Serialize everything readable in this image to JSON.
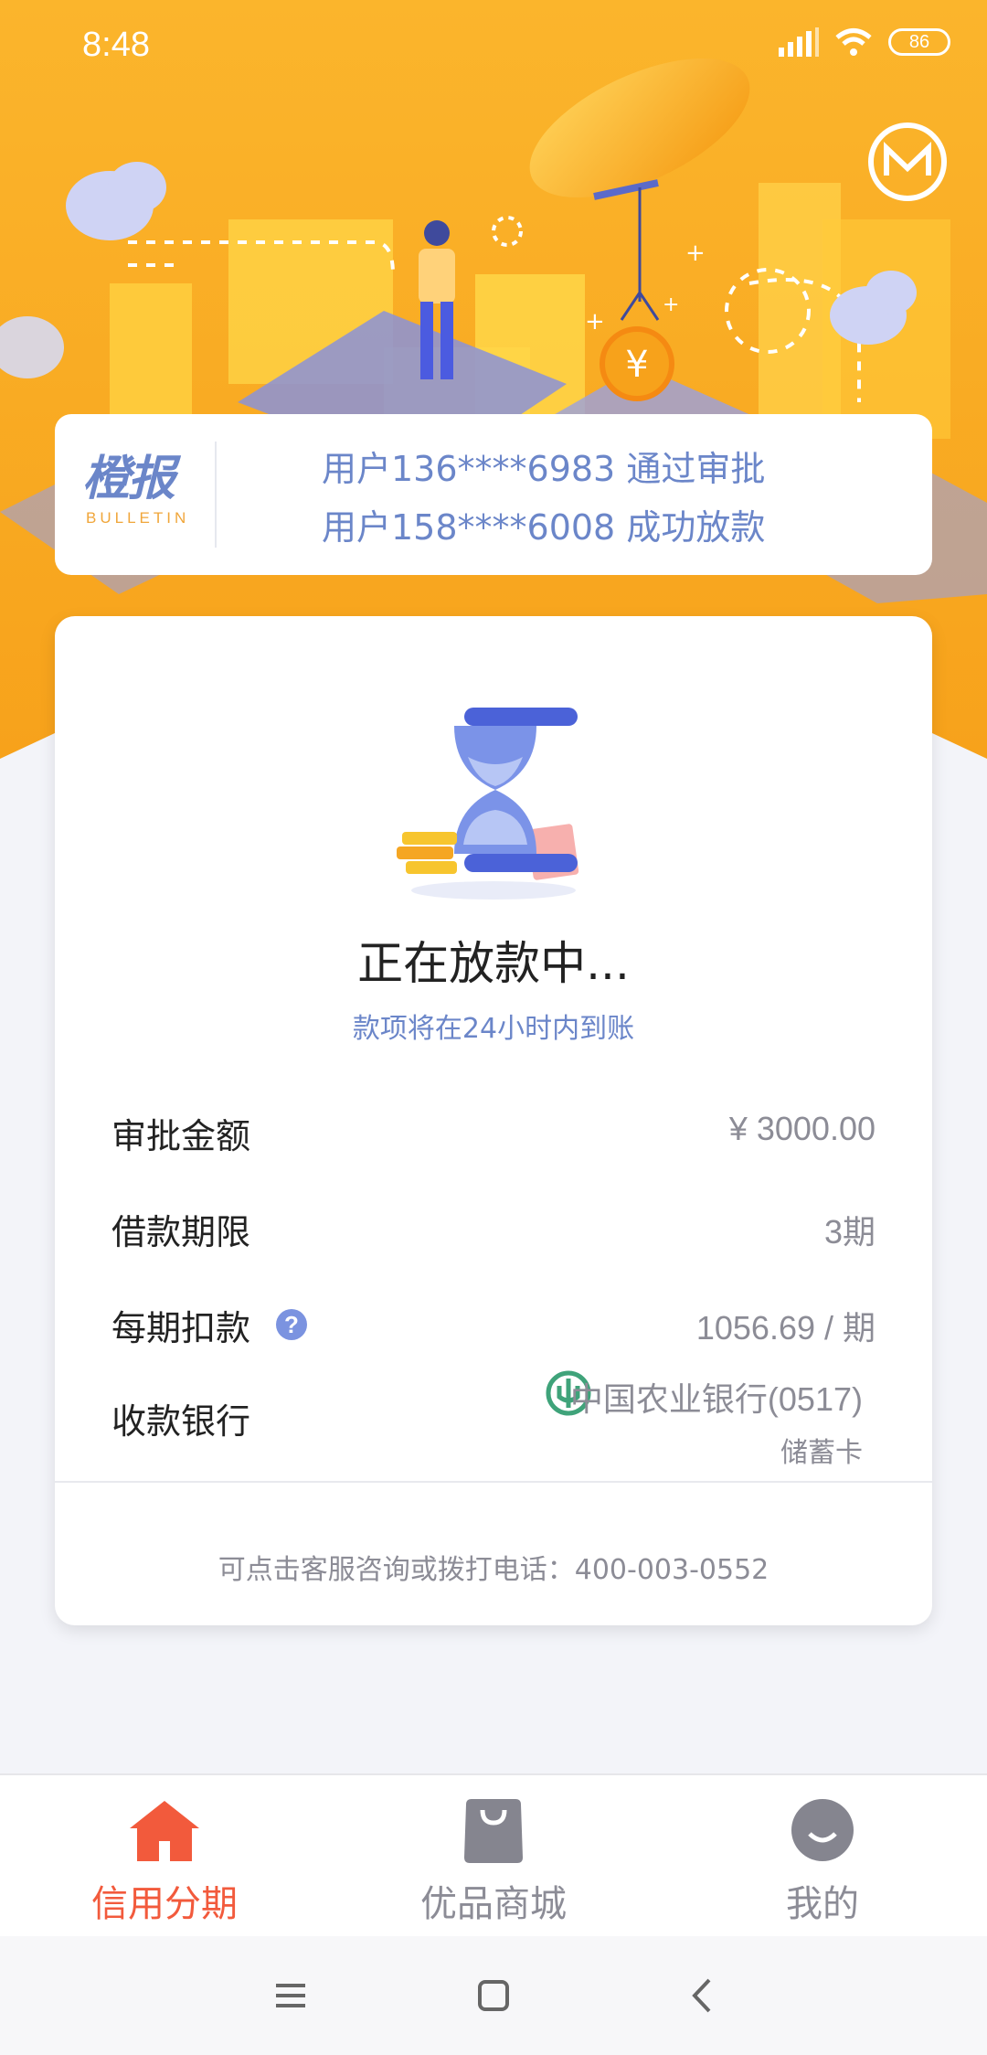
{
  "status_bar": {
    "time": "8:48",
    "battery": "86",
    "icons": [
      "signal-icon",
      "wifi-icon",
      "battery-icon"
    ]
  },
  "header": {
    "logo_icon": "circle-m-logo-icon"
  },
  "bulletin": {
    "logo_cn": "橙报",
    "logo_en": "BULLETIN",
    "lines": [
      "用户136****6983 通过审批",
      "用户158****6008 成功放款"
    ]
  },
  "loan_status": {
    "icon": "hourglass-icon",
    "title": "正在放款中...",
    "subtitle": "款项将在24小时内到账"
  },
  "details": {
    "approved_amount": {
      "label": "审批金额",
      "value": "¥ 3000.00"
    },
    "loan_term": {
      "label": "借款期限",
      "value": "3期"
    },
    "installment": {
      "label": "每期扣款",
      "value": "1056.69 / 期",
      "help_icon": "question-icon"
    },
    "receiving_bank": {
      "label": "收款银行",
      "bank_name": "中国农业银行(0517)",
      "card_type": "储蓄卡",
      "bank_icon": "abc-bank-icon"
    }
  },
  "contact": {
    "text": "可点击客服咨询或拨打电话：400-003-0552"
  },
  "tabs": [
    {
      "label": "信用分期",
      "icon": "home-icon",
      "active": true
    },
    {
      "label": "优品商城",
      "icon": "shopping-bag-icon",
      "active": false
    },
    {
      "label": "我的",
      "icon": "profile-icon",
      "active": false
    }
  ],
  "colors": {
    "accent_orange": "#f7a21b",
    "link_blue": "#6b86c9",
    "active_tab": "#f25a3c",
    "inactive_tab": "#8c8c96"
  }
}
